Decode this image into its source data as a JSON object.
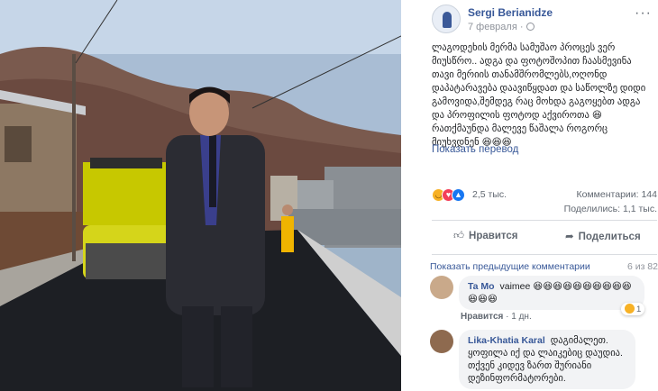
{
  "post": {
    "author": "Sergi Berianidze",
    "date": "7 февраля",
    "date_separator": "·",
    "more_icon": "more-horizontal-icon",
    "text": "ლაგოდეხის მერმა სამუშაო პროცეს ვერ მიუსწრო.. ადგა და ფოტოშოპით ჩაასმევინა თავი მერიის თანამშრომლებს,ოღონდ დაპატარავება დაავიწყდათ და საწოლზე დიდი გამოვიდა,შემდეგ რაც მოხდა გაგოყებთ ადგა და პროფილის ფოტოდ აქვიროთა 😆 რათქმაუნდა მალევე წაშალა როგორც მიუხვდნენ 😆😆😆",
    "translate_link": "Показать перевод"
  },
  "stats": {
    "reactions_count": "2,5 тыс.",
    "comments_label": "Комментарии: 144",
    "shares_label": "Поделились: 1,1 тыс."
  },
  "actions": {
    "like_label": "Нравится",
    "share_label": "Поделиться"
  },
  "comments_section": {
    "prev_link": "Показать предыдущие комментарии",
    "page_counter": "6 из 82",
    "items": [
      {
        "name": "Ta Mo",
        "text": "vaimee 😆😆😆😆😆😆😆😆😆😆😆😆😆",
        "like_label": "Нравится",
        "age": "1 дн.",
        "reaction_count": "1"
      },
      {
        "name": "Lika-Khatia Karal",
        "text": "დაგიმალეთ. ყოფილა იქ და ლაიკებიც დაუდია. თქვენ კიდევ ზართ შურიანი დეზინფორმატორები."
      }
    ]
  },
  "colors": {
    "link": "#385898",
    "meta": "#90949c",
    "bubble": "#f2f3f5"
  }
}
